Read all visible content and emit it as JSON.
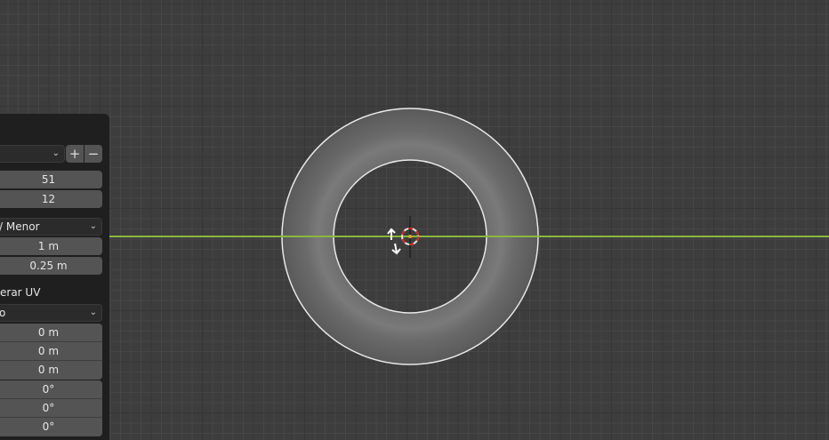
{
  "panel": {
    "preset_plus": "+",
    "preset_minus": "−",
    "major_segments": "51",
    "minor_segments": "12",
    "dimensions_mode": "/ Menor",
    "major_radius": "1 m",
    "minor_radius": "0.25 m",
    "generate_uv_label": "erar UV",
    "align_value": "o",
    "location": [
      "0 m",
      "0 m",
      "0 m"
    ],
    "rotation": [
      "0°",
      "0°",
      "0°"
    ]
  },
  "colors": {
    "x_axis": "#8cb83c",
    "background": "#3d3d3d"
  }
}
